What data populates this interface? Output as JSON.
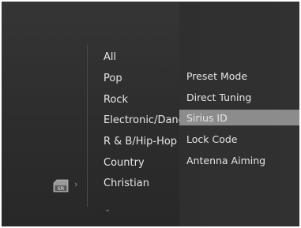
{
  "genres": [
    "All",
    "Pop",
    "Rock",
    "Electronic/Dance",
    "R & B/Hip-Hop",
    "Country",
    "Christian"
  ],
  "menu": {
    "items": [
      "Preset Mode",
      "Direct Tuning",
      "Sirius ID",
      "Lock Code",
      "Antenna Aiming"
    ],
    "selected": "Sirius ID"
  },
  "source_icon": {
    "label": "SR",
    "name": "sirius-radio-icon"
  },
  "arrows": {
    "right": "›",
    "down": "⌄"
  },
  "colors": {
    "background": "#2e2e2e",
    "text": "#e6e6e6",
    "highlight": "#8c8c8c"
  }
}
